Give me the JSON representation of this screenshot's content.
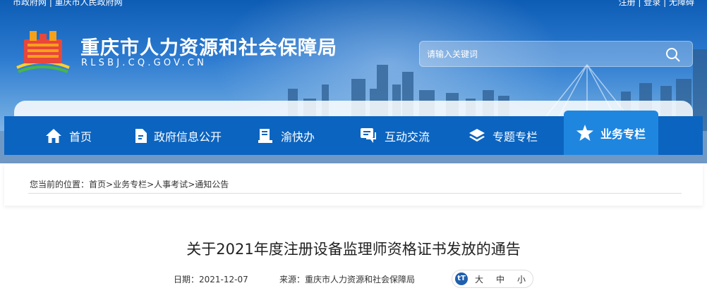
{
  "top_links": {
    "left": "市政府网 | 重庆市人民政府网",
    "register": "注册",
    "login": "登录",
    "accessible": "无障碍"
  },
  "site": {
    "title": "重庆市人力资源和社会保障局",
    "domain": "RLSBJ.CQ.GOV.CN"
  },
  "search": {
    "placeholder": "请输入关键词"
  },
  "nav": [
    {
      "label": "首页",
      "icon": "home-icon"
    },
    {
      "label": "政府信息公开",
      "icon": "document-icon"
    },
    {
      "label": "渝快办",
      "icon": "service-icon"
    },
    {
      "label": "互动交流",
      "icon": "chat-icon"
    },
    {
      "label": "专题专栏",
      "icon": "layers-icon"
    },
    {
      "label": "业务专栏",
      "icon": "star-icon",
      "active": true
    }
  ],
  "breadcrumb": {
    "prefix": "您当前的位置：",
    "items": [
      "首页",
      "业务专栏",
      "人事考试",
      "通知公告"
    ],
    "separator": ">"
  },
  "article": {
    "title": "关于2021年度注册设备监理师资格证书发放的通告",
    "date_label": "日期：",
    "date": "2021-12-07",
    "source_label": "来源：",
    "source": "重庆市人力资源和社会保障局"
  },
  "font_size": {
    "icon_text": "tT",
    "large": "大",
    "medium": "中",
    "small": "小"
  },
  "colors": {
    "nav_bg": "#0b64c0",
    "nav_active": "#1f86e0"
  }
}
